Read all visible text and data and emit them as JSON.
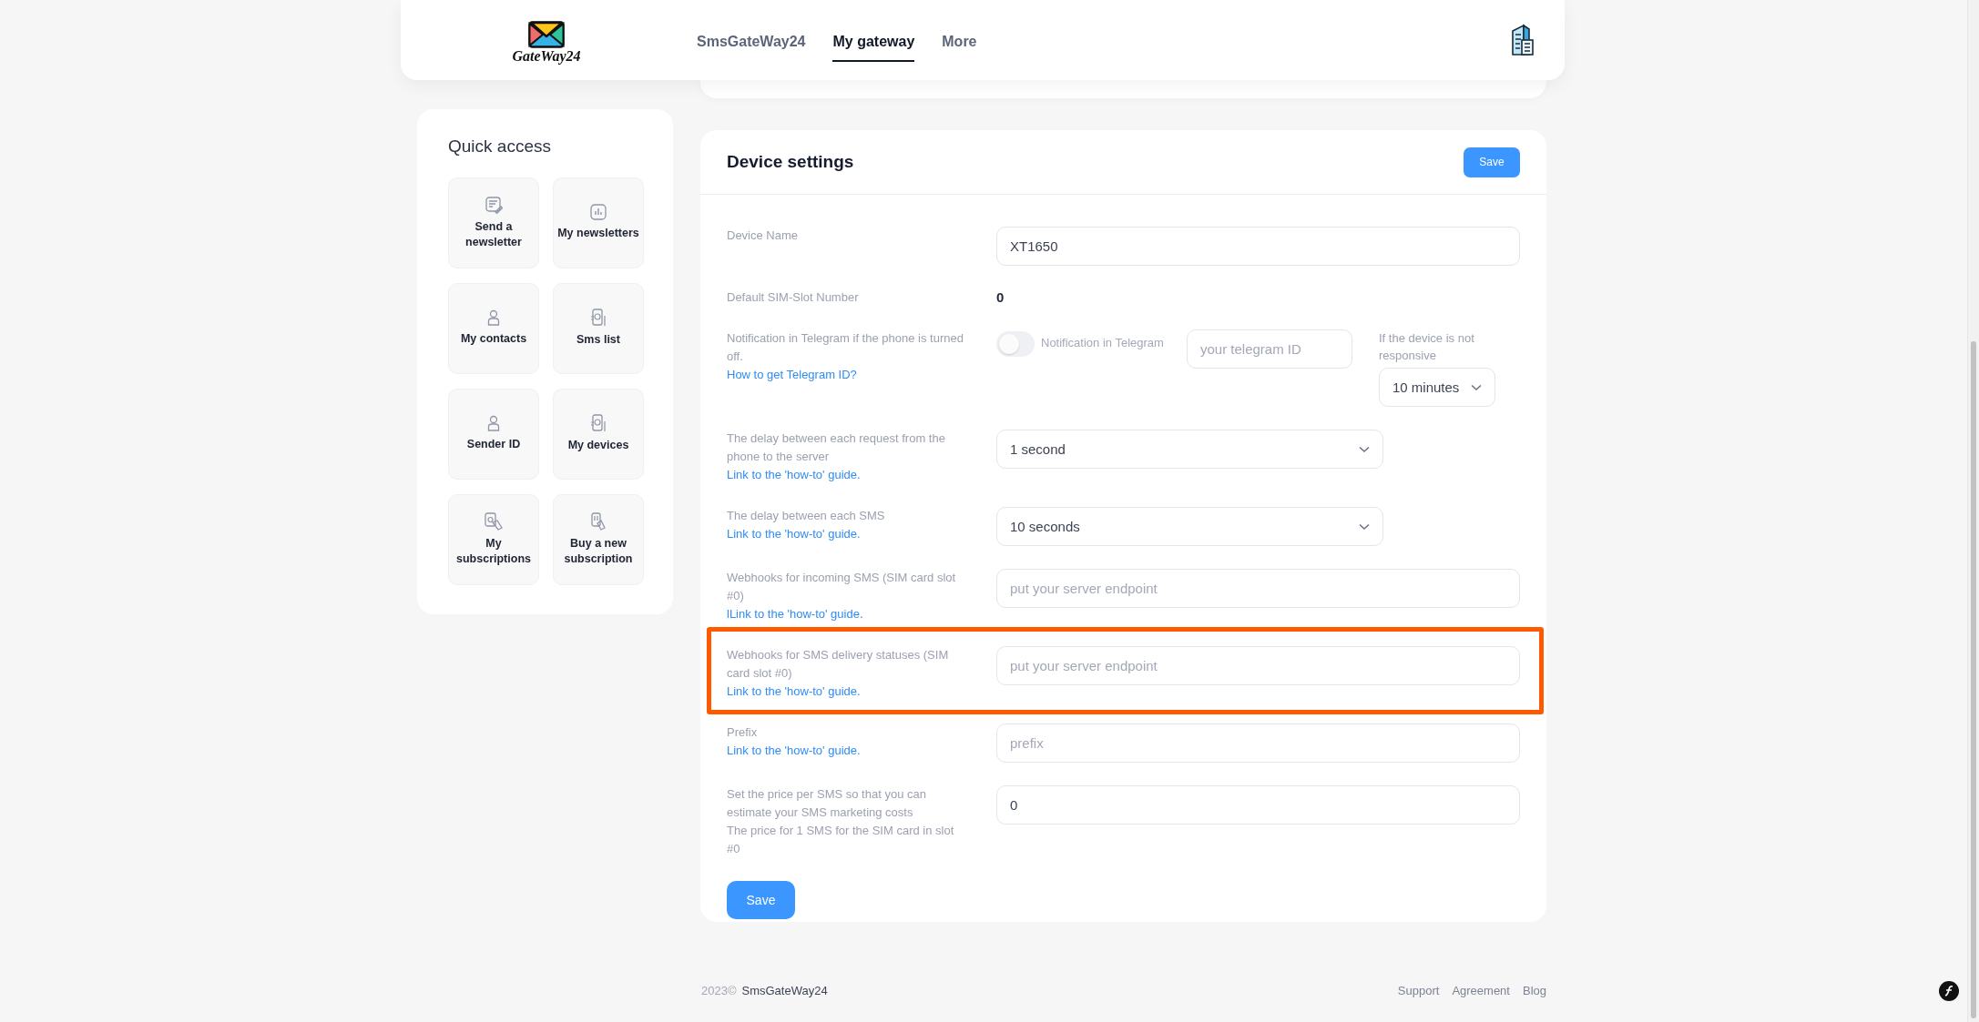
{
  "header": {
    "logo_text": "GateWay24",
    "nav": [
      {
        "label": "SmsGateWay24",
        "selected": false
      },
      {
        "label": "My gateway",
        "selected": true
      },
      {
        "label": "More",
        "selected": false
      }
    ]
  },
  "quick_access": {
    "title": "Quick access",
    "items": [
      {
        "label": "Send a newsletter",
        "kind": "newsletter"
      },
      {
        "label": "My newsletters",
        "kind": "chart"
      },
      {
        "label": "My contacts",
        "kind": "person"
      },
      {
        "label": "Sms list",
        "kind": "phone"
      },
      {
        "label": "Sender ID",
        "kind": "person"
      },
      {
        "label": "My devices",
        "kind": "phone"
      },
      {
        "label": "My subscriptions",
        "kind": "cardhand"
      },
      {
        "label": "Buy a new subscription",
        "kind": "card"
      }
    ]
  },
  "device_settings": {
    "title": "Device settings",
    "save_top": "Save",
    "rows": [
      {
        "kind": "input",
        "label": [
          "Device Name"
        ],
        "value": "XT1650",
        "highlighted": false
      },
      {
        "kind": "static",
        "label": [
          "Default SIM-Slot Number"
        ],
        "value": "0"
      },
      {
        "kind": "telegram",
        "label": [
          "Notification in Telegram if the phone is turned off."
        ],
        "link": "How to get Telegram ID?",
        "toggle": {
          "label": "Notification in Telegram",
          "on": false
        },
        "id_placeholder": "your telegram ID",
        "timeout_label": "If the device is not responsive",
        "timeout": "10 minutes"
      },
      {
        "kind": "select",
        "label": [
          "The delay between each request from the phone to the server"
        ],
        "link": "Link to the 'how-to' guide.",
        "value": "1 second"
      },
      {
        "kind": "select",
        "label": [
          "The delay between each SMS"
        ],
        "link": "Link to the 'how-to' guide.",
        "value": "10 seconds"
      },
      {
        "kind": "input",
        "label": [
          "Webhooks for incoming SMS (SIM card slot #0)"
        ],
        "link": "lLink to the 'how-to' guide.",
        "placeholder": "put your server endpoint",
        "highlighted": false
      },
      {
        "kind": "input",
        "label": [
          "Webhooks for SMS delivery statuses (SIM card slot #0)"
        ],
        "link": "Link to the 'how-to' guide.",
        "placeholder": "put your server endpoint",
        "highlighted": true
      },
      {
        "kind": "input",
        "label": [
          "Prefix"
        ],
        "link": "Link to the 'how-to' guide.",
        "placeholder": "prefix",
        "highlighted": false
      },
      {
        "kind": "input",
        "label": [
          "Set the price per SMS so that you can estimate your SMS marketing costs",
          "The price for 1 SMS for the SIM card in slot #0"
        ],
        "value": "0",
        "highlighted": false
      }
    ],
    "save_bottom": "Save"
  },
  "footer": {
    "year": "2023©",
    "brand": "SmsGateWay24",
    "links": [
      "Support",
      "Agreement",
      "Blog"
    ]
  }
}
